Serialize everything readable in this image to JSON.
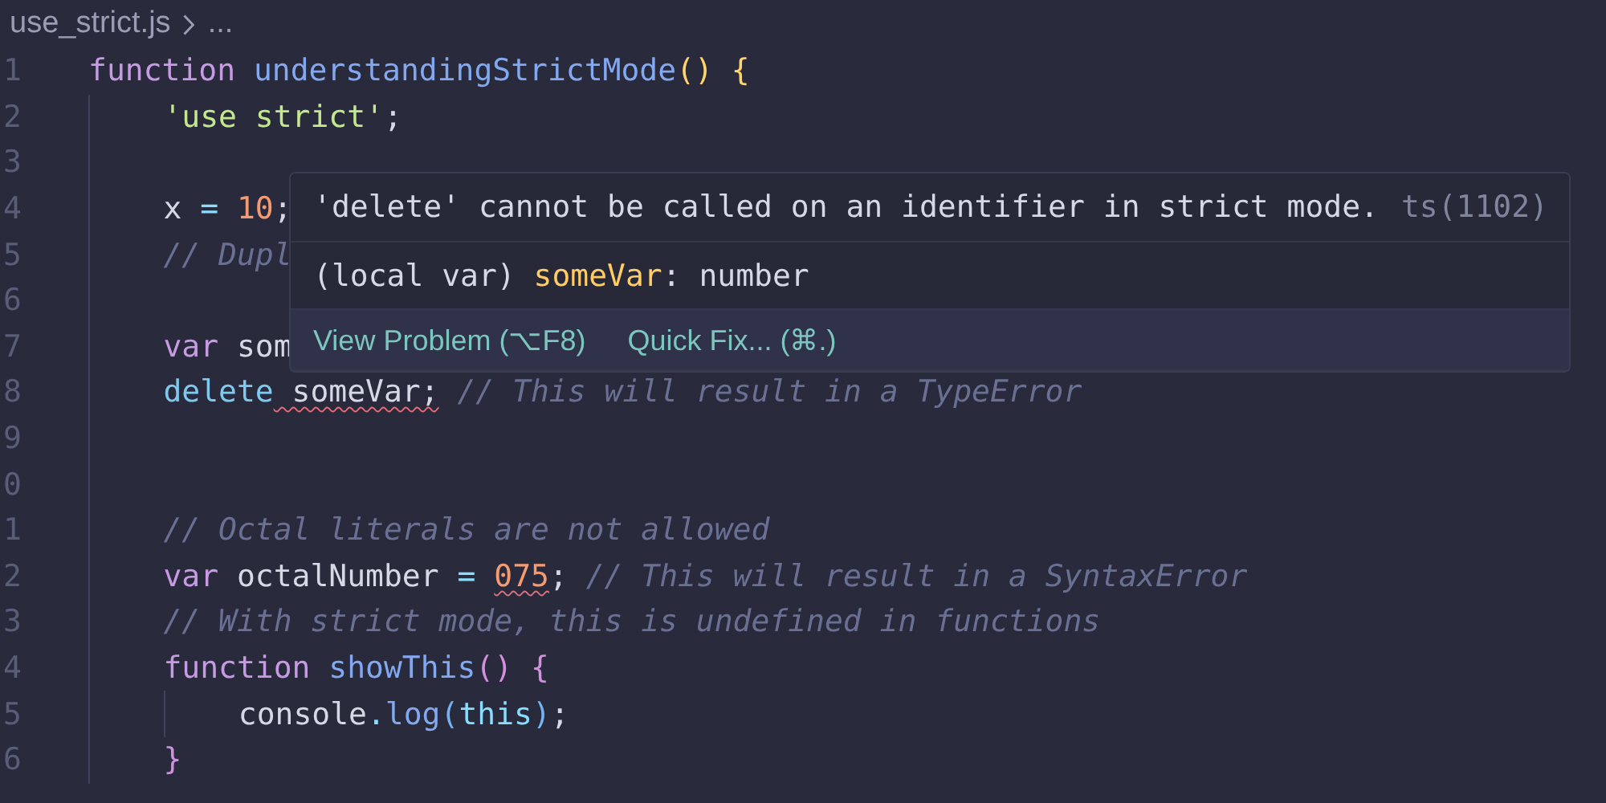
{
  "breadcrumb": {
    "file": "use_strict.js",
    "more": "..."
  },
  "lines": [
    {
      "number": "1",
      "tokens": [
        {
          "kind": "keyword",
          "text": "function"
        },
        {
          "kind": "function",
          "text": " understandingStrictMode"
        },
        {
          "kind": "bracket1",
          "text": "()"
        },
        {
          "kind": "bracket1",
          "text": " {"
        }
      ],
      "children": [
        {
          "number": "2",
          "tokens": [
            {
              "kind": "string",
              "text": "'use strict'"
            },
            {
              "kind": "plain",
              "text": ";"
            }
          ]
        },
        {
          "number": "3"
        },
        {
          "number": "4",
          "tokens": [
            {
              "kind": "plain",
              "text": "x"
            },
            {
              "kind": "punct",
              "text": " = "
            },
            {
              "kind": "number",
              "text": "10"
            },
            {
              "kind": "plain",
              "text": ";"
            }
          ]
        },
        {
          "number": "5",
          "tokens": [
            {
              "kind": "comment",
              "text": "// Dupl"
            }
          ]
        },
        {
          "number": "6"
        },
        {
          "number": "7",
          "tokens": [
            {
              "kind": "keyword",
              "text": "var"
            },
            {
              "kind": "plain",
              "text": " som"
            }
          ]
        },
        {
          "number": "8",
          "tokens": [
            {
              "kind": "operator",
              "text": "delete"
            },
            {
              "kind": "plain",
              "text": " someVar;",
              "error": true
            },
            {
              "kind": "comment",
              "text": " // This will result in a TypeError"
            }
          ]
        },
        {
          "number": "9"
        },
        {
          "number": "0"
        },
        {
          "number": "1",
          "tokens": [
            {
              "kind": "comment",
              "text": "// Octal literals are not allowed"
            }
          ]
        },
        {
          "number": "2",
          "tokens": [
            {
              "kind": "keyword",
              "text": "var"
            },
            {
              "kind": "plain",
              "text": " octalNumber"
            },
            {
              "kind": "punct",
              "text": " = "
            },
            {
              "kind": "number",
              "text": "075",
              "error": true
            },
            {
              "kind": "plain",
              "text": ";"
            },
            {
              "kind": "comment",
              "text": " // This will result in a SyntaxError"
            }
          ]
        },
        {
          "number": "3",
          "tokens": [
            {
              "kind": "comment",
              "text": "// With strict mode, this is undefined in functions"
            }
          ]
        },
        {
          "number": "4",
          "tokens": [
            {
              "kind": "keyword",
              "text": "function"
            },
            {
              "kind": "function",
              "text": " showThis"
            },
            {
              "kind": "bracket2",
              "text": "()"
            },
            {
              "kind": "bracket2",
              "text": " {"
            }
          ],
          "children": [
            {
              "number": "5",
              "tokens": [
                {
                  "kind": "plain",
                  "text": "console"
                },
                {
                  "kind": "punct",
                  "text": "."
                },
                {
                  "kind": "function",
                  "text": "log"
                },
                {
                  "kind": "bracket3",
                  "text": "("
                },
                {
                  "kind": "this",
                  "text": "this"
                },
                {
                  "kind": "bracket3",
                  "text": ")"
                },
                {
                  "kind": "plain",
                  "text": ";"
                }
              ]
            }
          ]
        },
        {
          "number": "6",
          "tokens": [
            {
              "kind": "bracket2",
              "text": "}"
            }
          ]
        }
      ]
    }
  ],
  "hover": {
    "message": "'delete' cannot be called on an identifier in strict mode.",
    "code": "ts(1102)",
    "signature": [
      {
        "kind": "plain",
        "text": "(local var) "
      },
      {
        "kind": "variable",
        "text": "someVar"
      },
      {
        "kind": "plain",
        "text": ": number"
      }
    ],
    "actions": [
      "View Problem (⌥F8)",
      "Quick Fix... (⌘.)"
    ]
  }
}
